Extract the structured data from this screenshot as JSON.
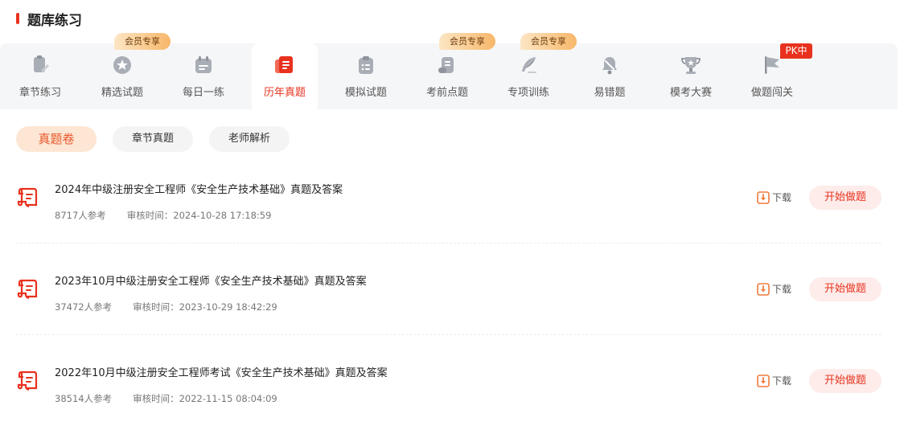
{
  "header": {
    "title": "题库练习"
  },
  "tabs": [
    {
      "label": "章节练习",
      "icon": "chapter-icon"
    },
    {
      "label": "精选试题",
      "icon": "star-badge-icon",
      "badge": "会员专享"
    },
    {
      "label": "每日一练",
      "icon": "calendar-icon"
    },
    {
      "label": "历年真题",
      "icon": "past-papers-icon",
      "active": true
    },
    {
      "label": "模拟试题",
      "icon": "clipboard-icon"
    },
    {
      "label": "考前点题",
      "icon": "scroll-icon",
      "badge": "会员专享"
    },
    {
      "label": "专项训练",
      "icon": "quill-icon",
      "badge": "会员专享"
    },
    {
      "label": "易错题",
      "icon": "bell-off-icon"
    },
    {
      "label": "模考大赛",
      "icon": "trophy-icon"
    },
    {
      "label": "做题闯关",
      "icon": "flag-icon",
      "badge": "PK中"
    }
  ],
  "filters": [
    {
      "label": "真题卷",
      "active": true
    },
    {
      "label": "章节真题"
    },
    {
      "label": "老师解析"
    }
  ],
  "items": [
    {
      "title": "2024年中级注册安全工程师《安全生产技术基础》真题及答案",
      "participants": "8717人参考",
      "review_time": "审核时间：2024-10-28 17:18:59",
      "download_label": "下载",
      "start_label": "开始做题"
    },
    {
      "title": "2023年10月中级注册安全工程师《安全生产技术基础》真题及答案",
      "participants": "37472人参考",
      "review_time": "审核时间：2023-10-29 18:42:29",
      "download_label": "下载",
      "start_label": "开始做题"
    },
    {
      "title": "2022年10月中级注册安全工程师考试《安全生产技术基础》真题及答案",
      "participants": "38514人参考",
      "review_time": "审核时间：2022-11-15 08:04:09",
      "download_label": "下载",
      "start_label": "开始做题"
    }
  ],
  "colors": {
    "accent": "#e8321e",
    "vip_badge": "#f7b76a",
    "chip_active": "#fde6d3"
  }
}
